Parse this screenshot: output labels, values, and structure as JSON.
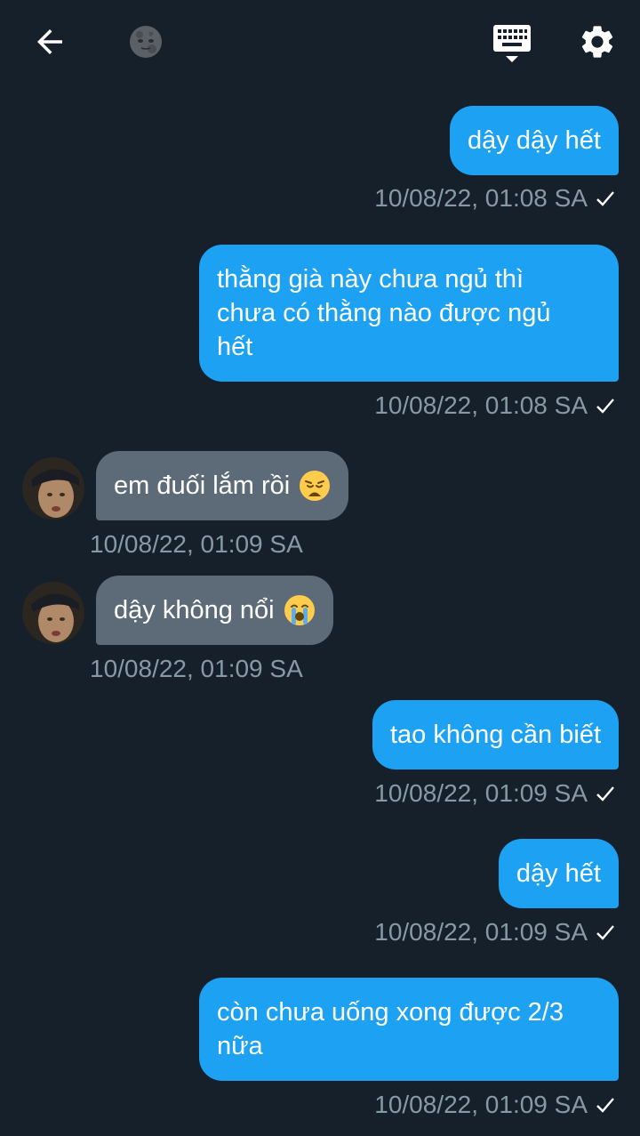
{
  "header": {
    "back_icon": "arrow-left-icon",
    "moon_icon": "new-moon-face-emoji",
    "keyboard_icon": "keyboard-icon",
    "settings_icon": "gear-icon"
  },
  "messages": [
    {
      "direction": "sent",
      "text": "dậy dậy hết",
      "time": "10/08/22, 01:08 SA"
    },
    {
      "direction": "sent",
      "text": "thằng già này chưa ngủ thì\nchưa có thằng nào được ngủ\nhết",
      "time": "10/08/22, 01:08 SA"
    },
    {
      "direction": "received",
      "text": "em đuối lắm rồi",
      "emoji": "weary-face",
      "time": "10/08/22, 01:09 SA"
    },
    {
      "direction": "received",
      "text": "dậy không nổi",
      "emoji": "loudly-crying-face",
      "time": "10/08/22, 01:09 SA"
    },
    {
      "direction": "sent",
      "text": "tao không cần biết",
      "time": "10/08/22, 01:09 SA"
    },
    {
      "direction": "sent",
      "text": "dậy hết",
      "time": "10/08/22, 01:09 SA"
    },
    {
      "direction": "sent",
      "text": "còn chưa uống xong được 2/3\nnữa",
      "time": "10/08/22, 01:09 SA"
    }
  ],
  "colors": {
    "background": "#15202b",
    "sent_bubble": "#1da1f2",
    "received_bubble": "#5d6b78",
    "timestamp": "#8899a6"
  }
}
